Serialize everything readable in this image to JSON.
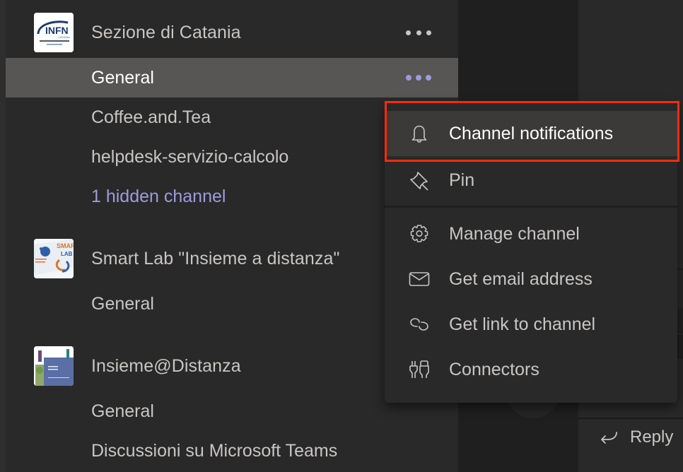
{
  "sidebar": {
    "teams": [
      {
        "name": "Sezione di Catania",
        "avatar": "infn-catania-logo",
        "more_icon": "more-horizontal-icon",
        "channels": [
          {
            "name": "General",
            "selected": true
          },
          {
            "name": "Coffee.and.Tea"
          },
          {
            "name": "helpdesk-servizio-calcolo"
          },
          {
            "name": "1 hidden channel",
            "type": "hidden-link"
          }
        ]
      },
      {
        "name": "Smart Lab \"Insieme a distanza\"",
        "avatar": "smart-lab-logo",
        "channels": [
          {
            "name": "General"
          }
        ]
      },
      {
        "name": "Insieme@Distanza",
        "avatar": "insieme-distanza-logo",
        "channels": [
          {
            "name": "General"
          },
          {
            "name": "Discussioni su Microsoft Teams"
          }
        ]
      }
    ]
  },
  "context_menu": {
    "items": [
      {
        "label": "Channel notifications",
        "icon": "bell-icon",
        "highlighted": true
      },
      {
        "label": "Pin",
        "icon": "pin-icon"
      },
      {
        "label": "Manage channel",
        "icon": "gear-icon"
      },
      {
        "label": "Get email address",
        "icon": "envelope-icon"
      },
      {
        "label": "Get link to channel",
        "icon": "link-icon"
      },
      {
        "label": "Connectors",
        "icon": "connectors-icon"
      }
    ]
  },
  "conversation": {
    "reply_label": "Reply",
    "reply_icon": "reply-arrow-icon"
  },
  "colors": {
    "accent": "#9c9be0",
    "highlight_box": "#ff2a0d",
    "selected_row": "#575655",
    "text": "#c8c6c4"
  }
}
